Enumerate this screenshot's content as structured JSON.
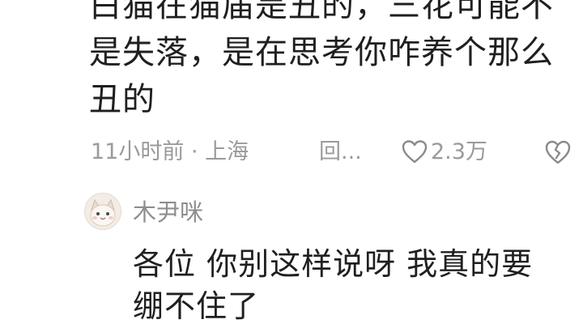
{
  "main_comment": {
    "lines": [
      "白猫在猫届是丑的，三花可能不",
      "是失落，是在思考你咋养个那么",
      "丑的"
    ],
    "time_location": "11小时前 · 上海",
    "reply_label": "回...",
    "like_icon": "heart-outline-icon",
    "like_count": "2.3万",
    "dislike_icon": "broken-heart-icon"
  },
  "reply": {
    "username": "木尹咪",
    "avatar_icon": "cat-avatar",
    "lines": [
      "各位 你别这样说呀 我真的要",
      "绷不住了"
    ]
  },
  "colors": {
    "text_primary": "#1f1f1f",
    "text_secondary": "#9a9a9a",
    "background": "#ffffff"
  }
}
